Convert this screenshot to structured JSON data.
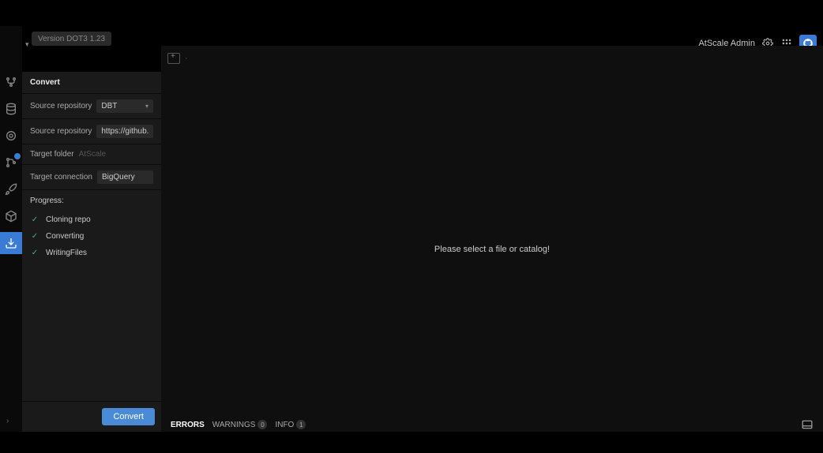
{
  "version": "Version DOT3 1.23",
  "admin": "AtScale Admin",
  "panel": {
    "title": "Convert",
    "source_repo_label": "Source repository",
    "source_repo_value": "DBT",
    "source_repo_url_label": "Source repository",
    "source_repo_url_value": "https://github.com/dbt-la",
    "target_folder_label": "Target folder",
    "target_folder_placeholder": "AtScale",
    "target_conn_label": "Target connection",
    "target_conn_value": "BigQuery",
    "progress_title": "Progress:",
    "progress": [
      "Cloning repo",
      "Converting",
      "WritingFiles"
    ],
    "button": "Convert"
  },
  "content_empty": "Please select a file or catalog!",
  "bottom": {
    "errors": "ERRORS",
    "warnings": "WARNINGS",
    "warnings_count": "0",
    "info": "INFO",
    "info_count": "1"
  }
}
